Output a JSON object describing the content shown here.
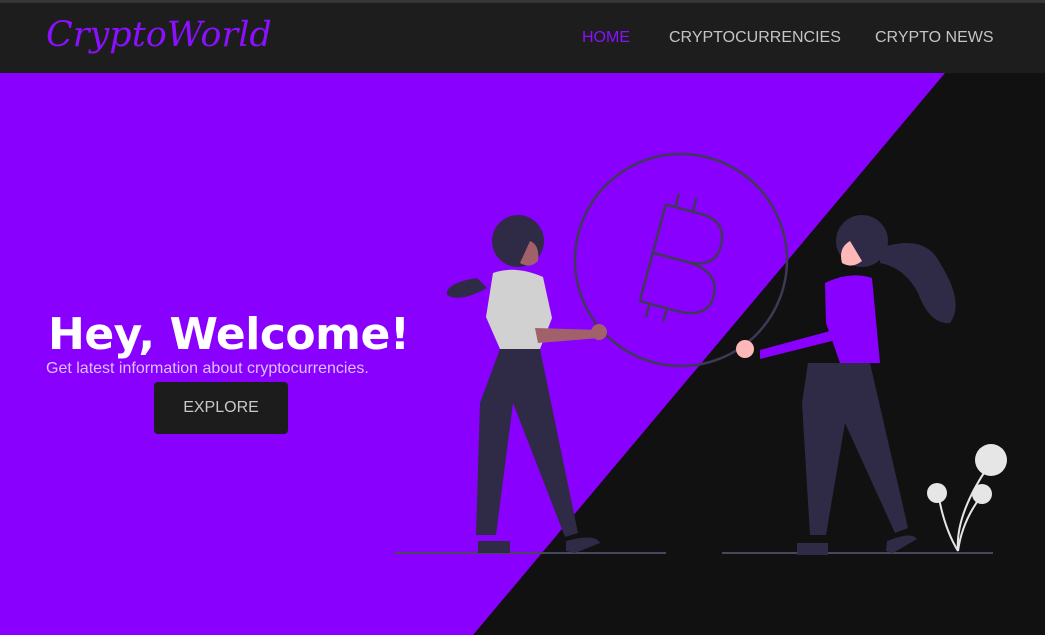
{
  "brand": {
    "logo_text": "CryptoWorld"
  },
  "nav": {
    "items": [
      {
        "label": "HOME",
        "active": true
      },
      {
        "label": "CRYPTOCURRENCIES",
        "active": false
      },
      {
        "label": "CRYPTO NEWS",
        "active": false
      }
    ]
  },
  "hero": {
    "title": "Hey, Welcome!",
    "subtitle": "Get latest information about cryptocurrencies.",
    "cta_label": "EXPLORE",
    "illustration_icons": [
      "bitcoin-icon",
      "woman-figure",
      "plant-icon"
    ]
  },
  "colors": {
    "accent": "#8a00ff",
    "nav_background": "#1d1d1d",
    "dark_background": "#111111",
    "button_background": "#1c1c1c"
  }
}
